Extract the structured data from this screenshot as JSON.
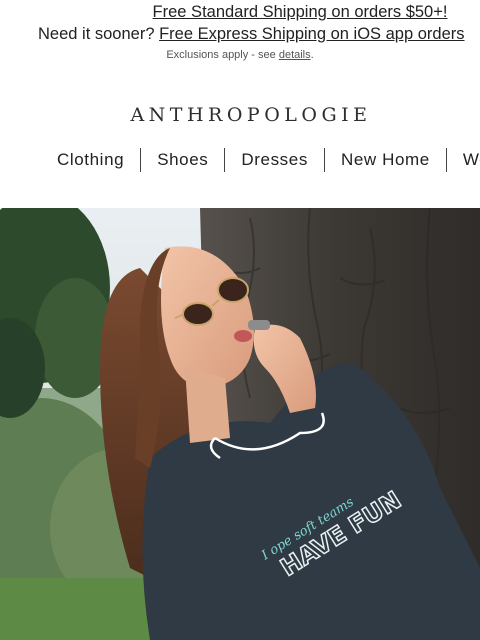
{
  "promo": {
    "line1_link": "Free Standard Shipping on orders $50+!",
    "line2_prefix": "Need it sooner?",
    "line2_link": "Free Express Shipping on iOS app orders",
    "exclusions_prefix": "Exclusions apply - see",
    "exclusions_link": "details",
    "exclusions_suffix": "."
  },
  "header": {
    "logo": "ANTHROPOLOGIE"
  },
  "nav": {
    "items": [
      "Clothing",
      "Shoes",
      "Dresses",
      "New Home",
      "We"
    ]
  },
  "hero": {
    "image": "woman-in-sunglasses-tshirt-under-tree",
    "shirt_text_script": "I ope soft teams",
    "shirt_text_bold": "HAVE FUN"
  },
  "colors": {
    "text": "#222222",
    "shirt": "#2f3a44",
    "bark": "#4a4540",
    "sky": "#dfe8ee",
    "foliage": "#3e5a36",
    "shirt_print": "#7fd6d1"
  }
}
